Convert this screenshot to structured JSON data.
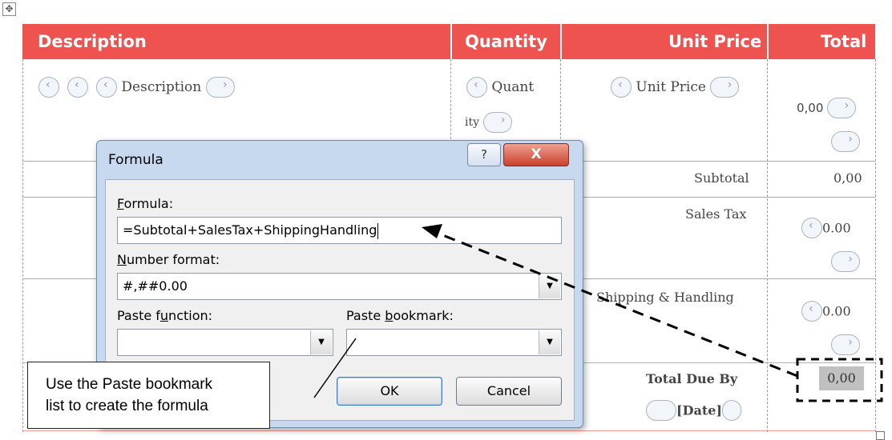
{
  "table": {
    "headers": {
      "description": "Description",
      "quantity": "Quantity",
      "unit_price": "Unit Price",
      "total": "Total"
    },
    "row1": {
      "description_field": "Description",
      "quantity_field_a": "Quant",
      "quantity_field_b": "ity",
      "unit_price_field": "Unit Price",
      "total_value": "0,00"
    },
    "subtotal": {
      "label": "Subtotal",
      "value": "0,00"
    },
    "sales_tax": {
      "label": "Sales Tax",
      "value": "0.00"
    },
    "shipping": {
      "label": "Shipping & Handling",
      "value": "0.00"
    },
    "total_due": {
      "label": "Total Due By",
      "date_field": "[Date]",
      "value": "0,00"
    }
  },
  "dialog": {
    "title": "Formula",
    "help_glyph": "?",
    "close_glyph": "X",
    "formula_label_first": "F",
    "formula_label_rest": "ormula:",
    "formula_value": "=Subtotal+SalesTax+ShippingHandling",
    "number_format_label_first": "N",
    "number_format_label_rest": "umber format:",
    "number_format_value": "#,##0.00",
    "paste_function_label_a": "Paste f",
    "paste_function_label_u": "u",
    "paste_function_label_b": "nction:",
    "paste_bookmark_label_a": "Paste ",
    "paste_bookmark_label_u": "b",
    "paste_bookmark_label_b": "ookmark:",
    "paste_function_value": "",
    "paste_bookmark_value": "",
    "ok_label": "OK",
    "cancel_label": "Cancel"
  },
  "callout": {
    "line1": "Use the Paste bookmark",
    "line2": "list to create the formula"
  },
  "colors": {
    "header_bg": "#ef5350",
    "dialog_frame": "#c7d9ee",
    "close_button": "#c8402c"
  }
}
